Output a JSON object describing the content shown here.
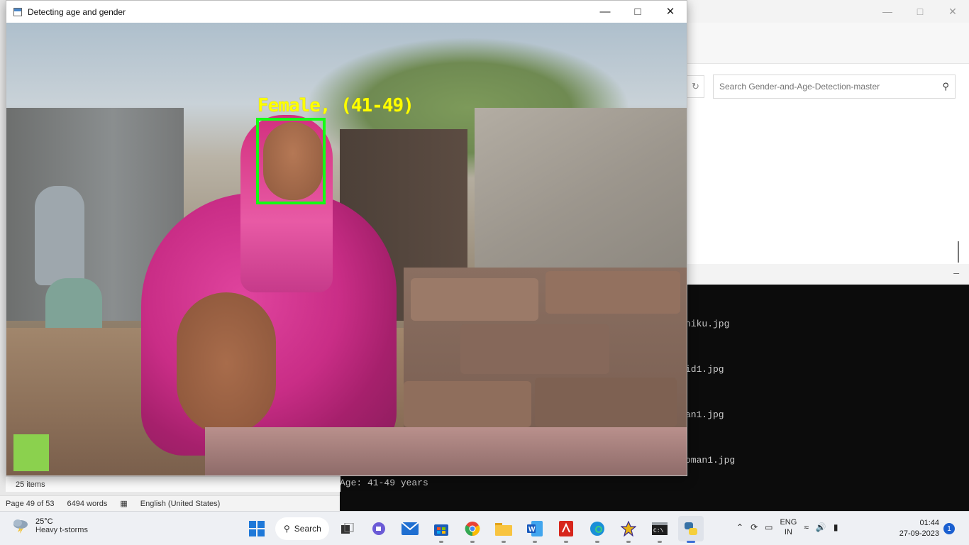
{
  "explorer": {
    "search_placeholder": "Search Gender-and-Age-Detection-master"
  },
  "terminal": {
    "lines": [
      "hiku.jpg",
      "id1.jpg",
      "an1.jpg",
      "oman1.jpg",
      "Age: 41-49 years"
    ]
  },
  "word_status": {
    "page": "Page 49 of 53",
    "words": "6494 words",
    "language": "English (United States)"
  },
  "explorer_left": {
    "items": "25 items"
  },
  "image_window": {
    "title": "Detecting age and gender",
    "face_label": "Female, (41-49)",
    "box_color": "#14ff14",
    "label_color": "#ffff00"
  },
  "taskbar": {
    "weather_temp": "25°C",
    "weather_cond": "Heavy t-storms",
    "search_label": "Search",
    "lang_top": "ENG",
    "lang_bottom": "IN",
    "time": "01:44",
    "date": "27-09-2023",
    "notification_count": "1"
  }
}
